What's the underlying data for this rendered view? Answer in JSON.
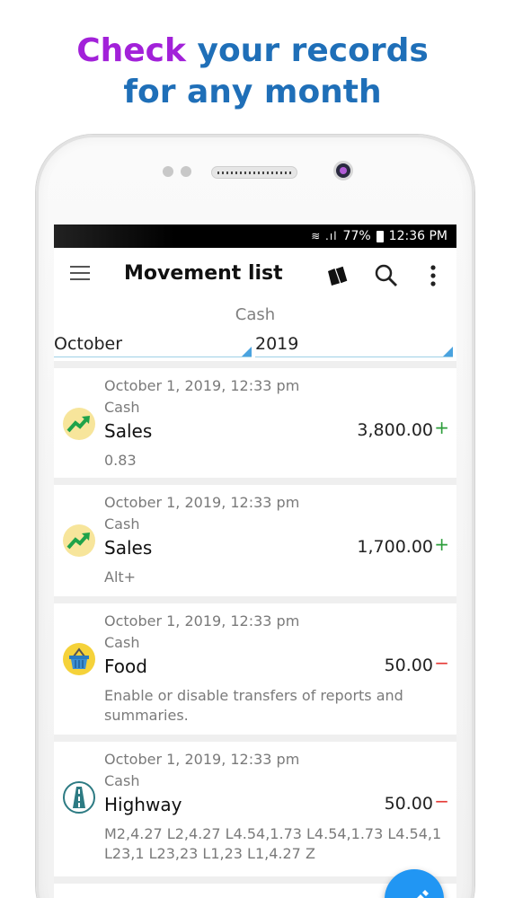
{
  "promo": {
    "headline_accent": "Check",
    "headline_line1_rest": " your records",
    "headline_line2": "for any month"
  },
  "status_bar": {
    "battery": "77%",
    "time": "12:36 PM"
  },
  "app_bar": {
    "title": "Movement list"
  },
  "filter": {
    "account": "Cash",
    "month": "October",
    "year": "2019"
  },
  "movements": [
    {
      "date": "October 1,  2019, 12:33 pm",
      "account": "Cash",
      "category": "Sales",
      "amount": "3,800.00",
      "sign": "+",
      "note": "0.83",
      "icon": "trend-up-icon"
    },
    {
      "date": "October 1,  2019, 12:33 pm",
      "account": "Cash",
      "category": "Sales",
      "amount": "1,700.00",
      "sign": "+",
      "note": "Alt+",
      "icon": "trend-up-icon"
    },
    {
      "date": "October 1,  2019, 12:33 pm",
      "account": "Cash",
      "category": "Food",
      "amount": "50.00",
      "sign": "−",
      "note": "Enable or disable transfers of reports and summaries.",
      "icon": "basket-icon"
    },
    {
      "date": "October 1,  2019, 12:33 pm",
      "account": "Cash",
      "category": "Highway",
      "amount": "50.00",
      "sign": "−",
      "note": "M2,4.27 L2,4.27 L4.54,1.73 L4.54,1.73 L4.54,1 L23,1 L23,23 L1,23 L1,4.27 Z",
      "icon": "road-icon"
    }
  ],
  "colors": {
    "accent": "#a221d9",
    "headline": "#1f6fb8",
    "fab": "#2196f3",
    "income": "#2e9e3c",
    "expense": "#e53935"
  }
}
